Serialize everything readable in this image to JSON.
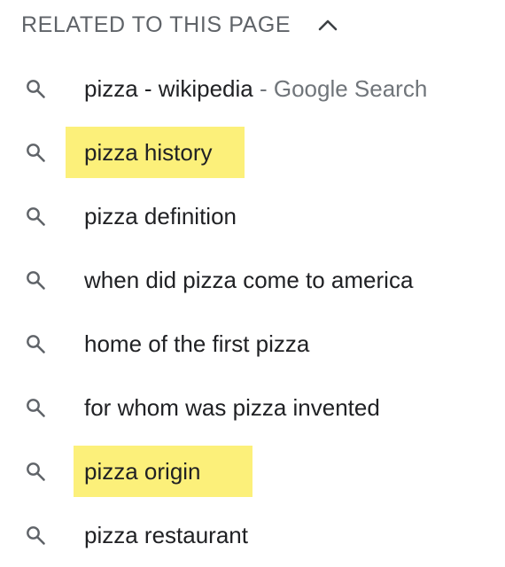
{
  "header": {
    "title": "RELATED TO THIS PAGE",
    "collapse_icon": "chevron-up-icon"
  },
  "colors": {
    "highlight": "#fcf07a",
    "header_text": "#5f6368",
    "item_text": "#202124",
    "secondary_text": "#70757a",
    "icon": "#5f6368"
  },
  "related": [
    {
      "query": "pizza - wikipedia",
      "suffix": " - Google Search",
      "highlighted": false
    },
    {
      "query": "pizza history",
      "suffix": "",
      "highlighted": true
    },
    {
      "query": "pizza definition",
      "suffix": "",
      "highlighted": false
    },
    {
      "query": "when did pizza come to america",
      "suffix": "",
      "highlighted": false
    },
    {
      "query": "home of the first pizza",
      "suffix": "",
      "highlighted": false
    },
    {
      "query": "for whom was pizza invented",
      "suffix": "",
      "highlighted": false
    },
    {
      "query": "pizza origin",
      "suffix": "",
      "highlighted": true
    },
    {
      "query": "pizza restaurant",
      "suffix": "",
      "highlighted": false
    }
  ]
}
